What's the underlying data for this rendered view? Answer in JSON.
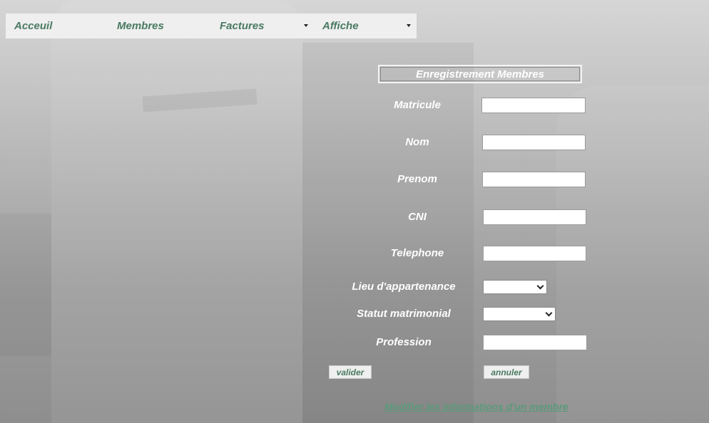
{
  "nav": {
    "items": [
      {
        "label": "Acceuil"
      },
      {
        "label": "Membres"
      },
      {
        "label": "Factures",
        "has_dropdown": true
      },
      {
        "label": "Affiche",
        "has_dropdown": true
      }
    ]
  },
  "form": {
    "title": "Enregistrement Membres",
    "fields": [
      {
        "label": "Matricule",
        "type": "text",
        "value": ""
      },
      {
        "label": "Nom",
        "type": "text",
        "value": ""
      },
      {
        "label": "Prenom",
        "type": "text",
        "value": ""
      },
      {
        "label": "CNI",
        "type": "text",
        "value": ""
      },
      {
        "label": "Telephone",
        "type": "text",
        "value": ""
      },
      {
        "label": "Lieu d'appartenance",
        "type": "select",
        "value": ""
      },
      {
        "label": "Statut matrimonial",
        "type": "select",
        "value": ""
      },
      {
        "label": "Profession",
        "type": "text",
        "value": ""
      }
    ],
    "buttons": {
      "submit": "valider",
      "cancel": "annuler"
    },
    "link": "Modifier les informations d'un membre"
  },
  "colors": {
    "accent_green": "#4a7a62",
    "link_green": "#5b9a7a",
    "navbar_bg": "#efefef"
  },
  "icons": {
    "dropdown": "chevron-down-icon"
  }
}
